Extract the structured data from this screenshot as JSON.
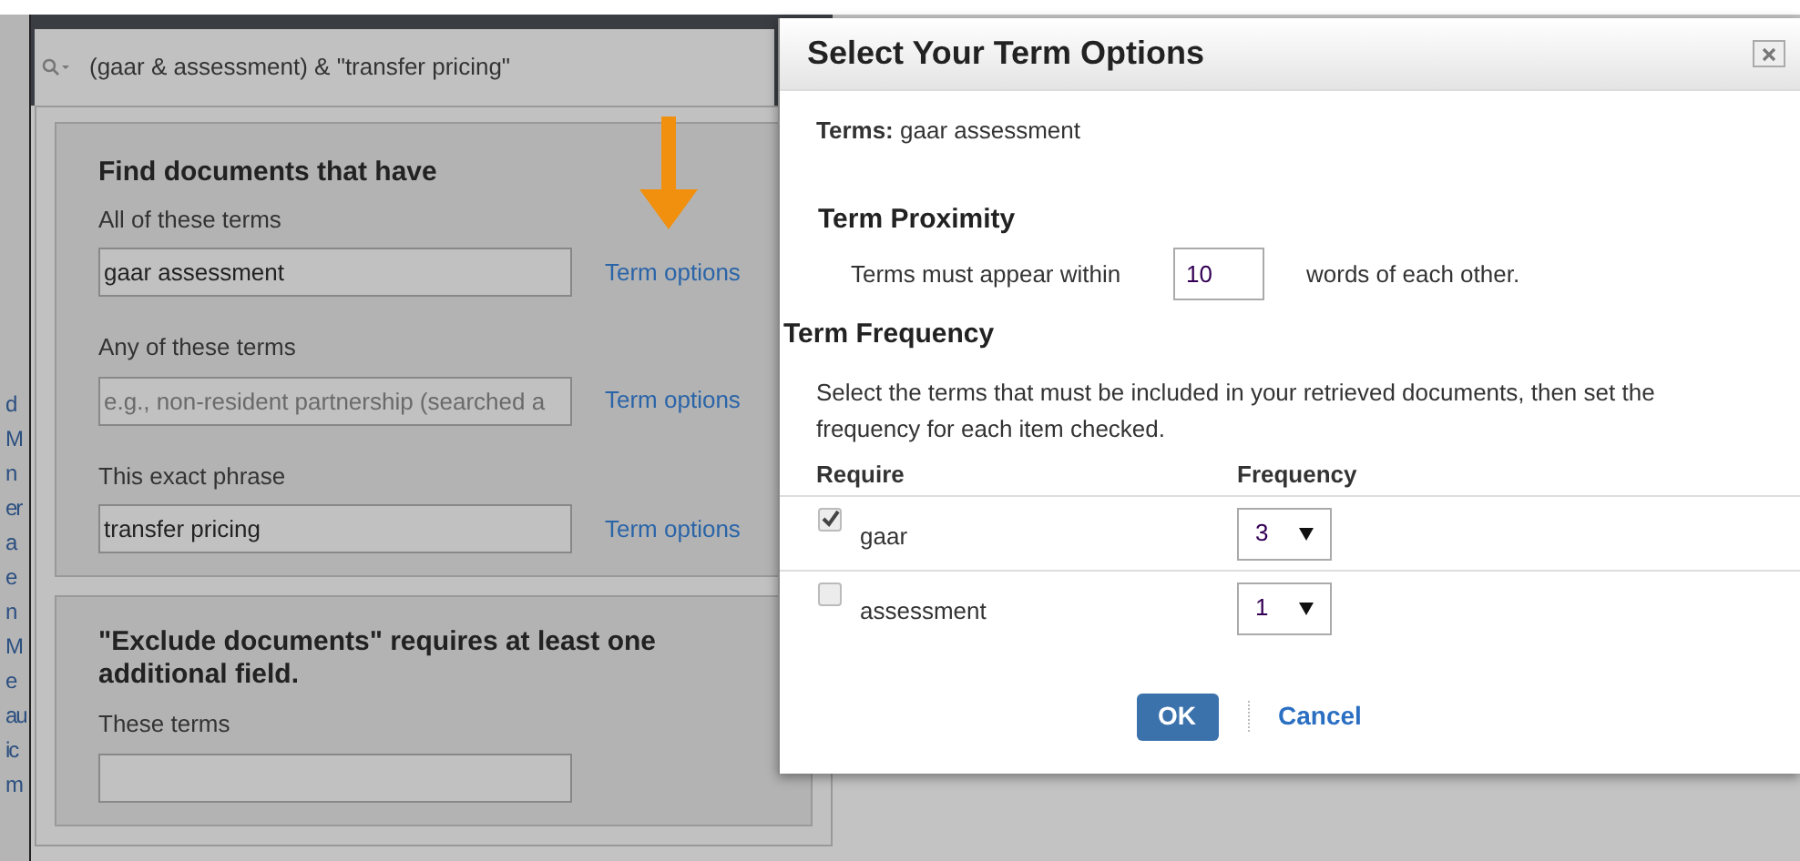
{
  "search_bar": {
    "query": "(gaar & assessment) & \"transfer pricing\""
  },
  "left_edge_fragments": [
    "d",
    "M",
    "n",
    "er",
    "a",
    "e",
    "n",
    "M",
    "e",
    "au",
    "ic",
    "m"
  ],
  "find_section": {
    "title": "Find documents that have",
    "fields": [
      {
        "label": "All of these terms",
        "value": "gaar assessment",
        "link": "Term options"
      },
      {
        "label": "Any of these terms",
        "placeholder": "e.g., non-resident partnership (searched a",
        "link": "Term options"
      },
      {
        "label": "This exact phrase",
        "value": "transfer pricing",
        "link": "Term options"
      }
    ]
  },
  "exclude_section": {
    "title": "\"Exclude documents\" requires at least one additional field.",
    "field_label": "These terms"
  },
  "dialog": {
    "title": "Select Your Term Options",
    "terms_label": "Terms:",
    "terms_value": "gaar assessment",
    "proximity": {
      "title": "Term Proximity",
      "before": "Terms must appear within",
      "value": "10",
      "after": "words of each other."
    },
    "frequency": {
      "title": "Term Frequency",
      "instructions": "Select the terms that must be included in your retrieved documents, then set the frequency for each item checked.",
      "columns": [
        "Require",
        "Frequency"
      ],
      "rows": [
        {
          "term": "gaar",
          "checked": true,
          "frequency": "3"
        },
        {
          "term": "assessment",
          "checked": false,
          "frequency": "1"
        }
      ]
    },
    "buttons": {
      "ok": "OK",
      "cancel": "Cancel"
    }
  }
}
